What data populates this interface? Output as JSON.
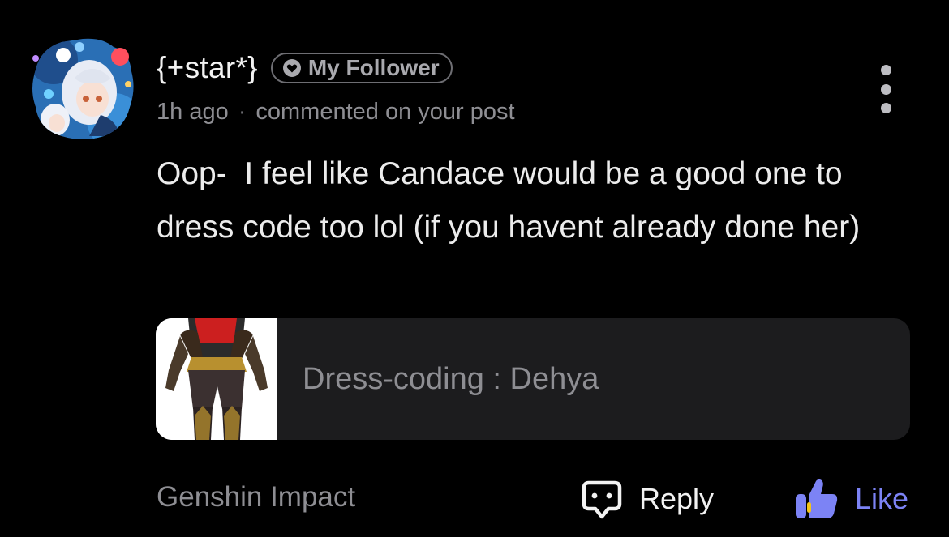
{
  "comment": {
    "username": "{+star*}",
    "badge": "My Follower",
    "time": "1h ago",
    "separator": "·",
    "action": "commented on your post",
    "text": "Oop-  I feel like Candace would be a good one to dress code too lol (if you havent already done her)"
  },
  "post": {
    "title": "Dress-coding : Dehya"
  },
  "footer": {
    "community": "Genshin Impact",
    "reply_label": "Reply",
    "like_label": "Like"
  },
  "icons": {
    "badge": "heart-icon",
    "more": "more-vertical-icon",
    "reply": "speech-bubble-icon",
    "like": "thumbs-up-icon"
  },
  "colors": {
    "background": "#000000",
    "text_primary": "#ececec",
    "text_secondary": "#8e8e93",
    "card_bg": "#1c1c1e",
    "like_accent": "#7c83f5",
    "like_highlight": "#f5c518"
  }
}
